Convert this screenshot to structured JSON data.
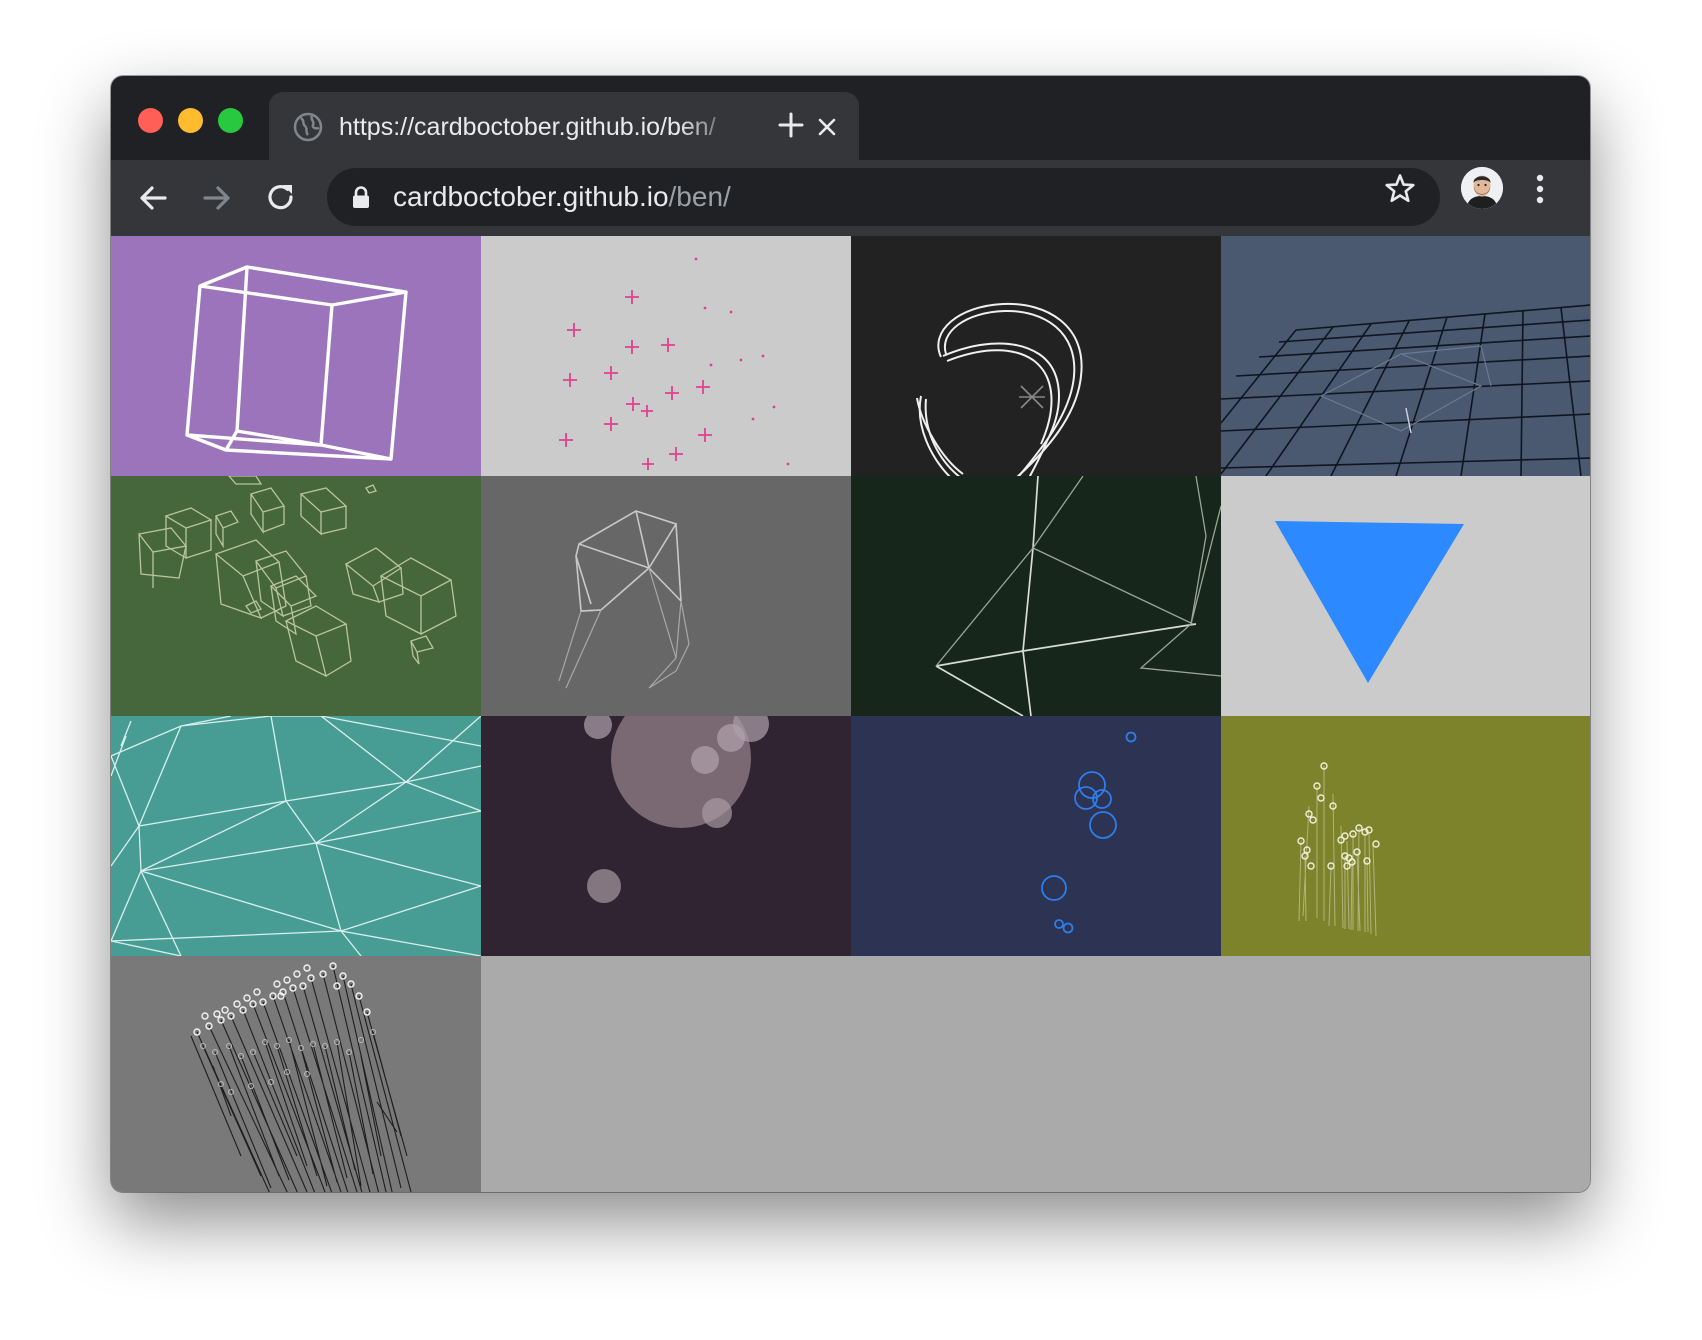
{
  "browser": {
    "tab": {
      "title": "https://cardboctober.github.io/ben/",
      "favicon": "globe-icon",
      "close_icon": "close-icon"
    },
    "new_tab_icon": "plus-icon",
    "toolbar": {
      "back_icon": "arrow-left-icon",
      "forward_icon": "arrow-right-icon",
      "reload_icon": "reload-icon",
      "lock_icon": "lock-icon",
      "url_host": "cardboctober.github.io",
      "url_path": "/ben/",
      "bookmark_icon": "star-icon",
      "profile_icon": "avatar",
      "menu_icon": "more-vert-icon"
    },
    "colors": {
      "tabstrip": "#202124",
      "toolbar": "#35363a",
      "omnibox": "#202124",
      "page_background": "#aaaaaa"
    }
  },
  "gallery": {
    "tiles": [
      {
        "name": "wireframe-cube",
        "background": "#9c74bc"
      },
      {
        "name": "pink-crosses",
        "background": "#cbcbcb"
      },
      {
        "name": "white-scribble",
        "background": "#222222"
      },
      {
        "name": "perspective-grid",
        "background": "#4a5970"
      },
      {
        "name": "floating-cubes",
        "background": "#46663b"
      },
      {
        "name": "gray-polyhedron",
        "background": "#676767"
      },
      {
        "name": "dark-green-lines",
        "background": "#17261a"
      },
      {
        "name": "blue-triangle",
        "background": "#cbcbcb"
      },
      {
        "name": "teal-triangulation",
        "background": "#479d94"
      },
      {
        "name": "translucent-circles",
        "background": "#312432"
      },
      {
        "name": "blue-rings",
        "background": "#2c3353"
      },
      {
        "name": "olive-dandelions",
        "background": "#7d832b"
      },
      {
        "name": "gray-dandelions",
        "background": "#797979"
      }
    ]
  }
}
